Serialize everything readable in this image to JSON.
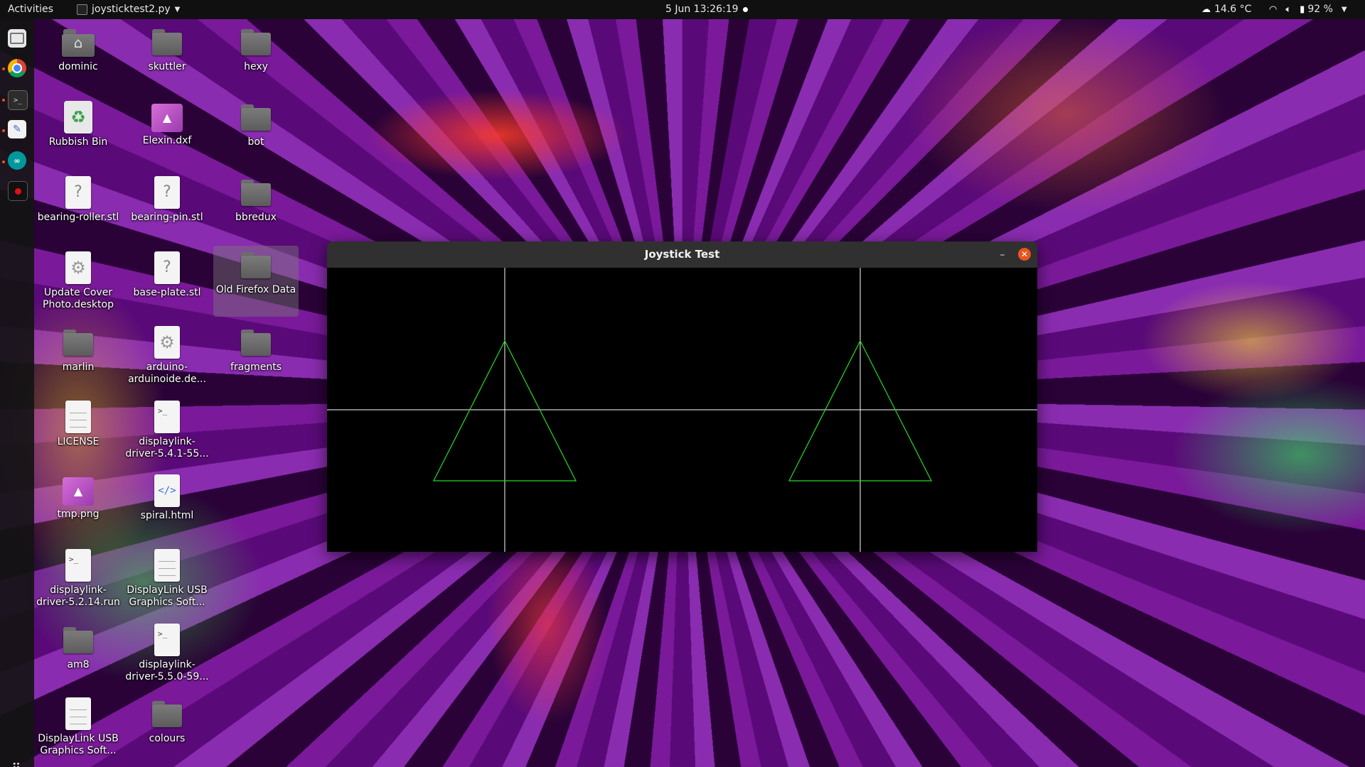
{
  "topbar": {
    "activities": "Activities",
    "app_name": "joysticktest2.py",
    "clock": "5 Jun  13:26:19",
    "weather": "14.6 °C",
    "battery": "92 %"
  },
  "dock": {
    "items": [
      {
        "name": "files",
        "icon": "files-icon"
      },
      {
        "name": "chrome",
        "icon": "chrome-icon"
      },
      {
        "name": "terminal",
        "icon": "terminal-icon"
      },
      {
        "name": "text-editor",
        "icon": "text-editor-icon"
      },
      {
        "name": "arduino",
        "icon": "arduino-icon"
      },
      {
        "name": "python-app",
        "icon": "app-icon"
      }
    ]
  },
  "desktop": {
    "icons": [
      {
        "label": "dominic",
        "type": "home"
      },
      {
        "label": "skuttler",
        "type": "folder"
      },
      {
        "label": "hexy",
        "type": "folder"
      },
      {
        "label": "Rubbish Bin",
        "type": "bin"
      },
      {
        "label": "Elexin.dxf",
        "type": "image"
      },
      {
        "label": "bot",
        "type": "folder"
      },
      {
        "label": "bearing-roller.stl",
        "type": "unknown"
      },
      {
        "label": "bearing-pin.stl",
        "type": "unknown"
      },
      {
        "label": "bbredux",
        "type": "folder"
      },
      {
        "label": "Update Cover\nPhoto.desktop",
        "type": "gear"
      },
      {
        "label": "base-plate.stl",
        "type": "unknown"
      },
      {
        "label": "Old Firefox Data",
        "type": "folder"
      },
      {
        "label": "marlin",
        "type": "folder"
      },
      {
        "label": "arduino-\narduinoide.de...",
        "type": "gear"
      },
      {
        "label": "fragments",
        "type": "folder"
      },
      {
        "label": "LICENSE",
        "type": "text"
      },
      {
        "label": "displaylink-\ndriver-5.4.1-55...",
        "type": "terminal"
      },
      {
        "label": "tmp.png",
        "type": "image"
      },
      {
        "label": "spiral.html",
        "type": "html"
      },
      {
        "label": "displaylink-\ndriver-5.2.14.run",
        "type": "terminal"
      },
      {
        "label": "DisplayLink USB\nGraphics Soft...",
        "type": "text"
      },
      {
        "label": "am8",
        "type": "folder"
      },
      {
        "label": "displaylink-\ndriver-5.5.0-59...",
        "type": "terminal"
      },
      {
        "label": "DisplayLink USB\nGraphics Soft...",
        "type": "text"
      },
      {
        "label": "colours",
        "type": "folder"
      }
    ]
  },
  "window": {
    "title": "Joystick Test",
    "minimize_symbol": "–",
    "close_symbol": "✕",
    "crosshair_color": "#ffffff",
    "triangle_color": "#22dd22"
  },
  "colors": {
    "accent": "#e95420",
    "topbar": "#101010",
    "titlebar": "#303030"
  }
}
